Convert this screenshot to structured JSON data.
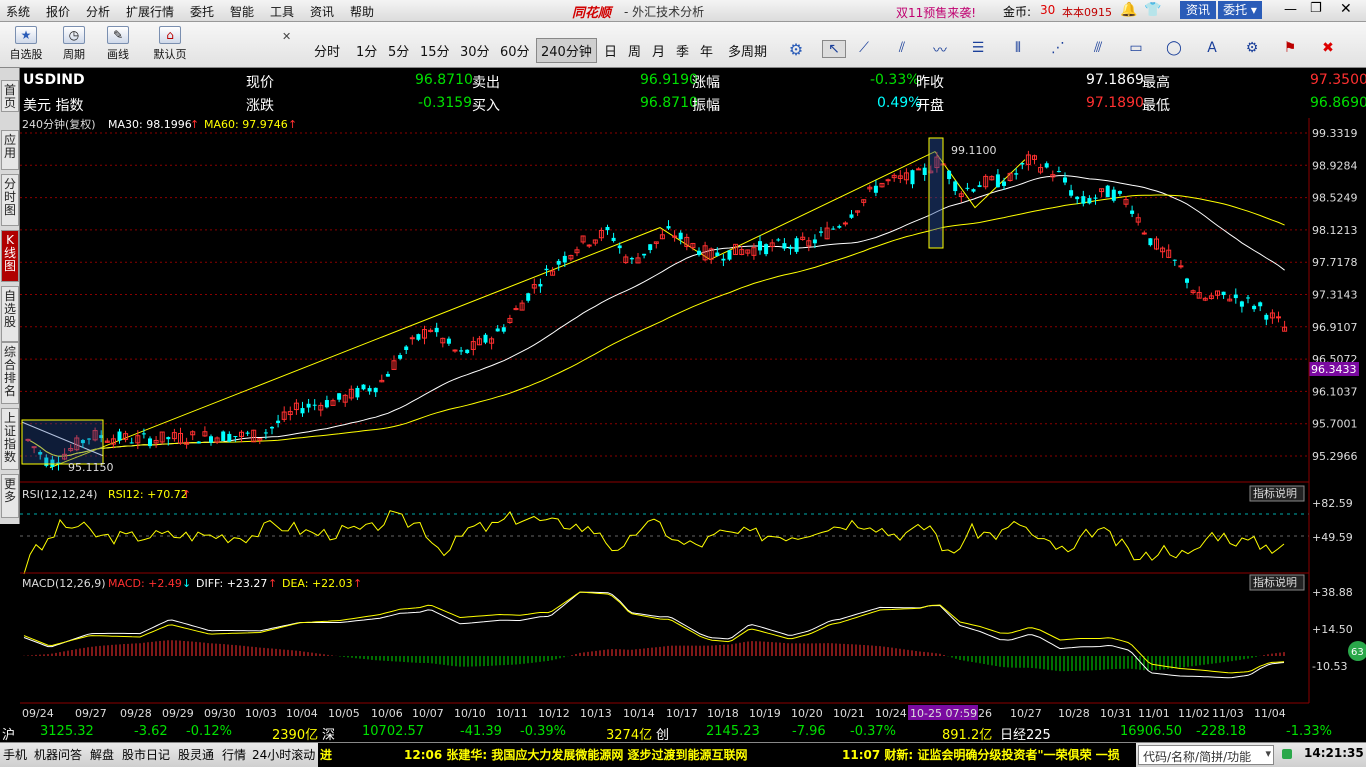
{
  "menu": {
    "items": [
      "系统",
      "报价",
      "分析",
      "扩展行情",
      "委托",
      "智能",
      "工具",
      "资讯",
      "帮助"
    ],
    "brand": "同花顺",
    "app_title": "外汇技术分析",
    "promo": "双11预售来袭!",
    "gold_label": "金币:",
    "gold_value": "30",
    "version": "本本0915",
    "btn_info": "资讯",
    "btn_trade": "委托"
  },
  "toolbar": {
    "left_buttons": [
      "自选股",
      "周期",
      "画线",
      "默认页"
    ],
    "periods": [
      "分时",
      "1分",
      "5分",
      "15分",
      "30分",
      "60分",
      "240分钟",
      "日",
      "周",
      "月",
      "季",
      "年",
      "多周期"
    ],
    "selected_period": "240分钟"
  },
  "sidebar": {
    "tabs": [
      "首页",
      "应用",
      "分时图",
      "K线图",
      "自选股",
      "综合排名",
      "上证指数",
      "更多"
    ],
    "active": "K线图"
  },
  "quote": {
    "symbol": "USDIND",
    "name": "美元 指数",
    "label_now": "现价",
    "now": "96.8710",
    "label_sell": "卖出",
    "sell": "96.9190",
    "label_chg_pct": "涨幅",
    "chg_pct": "-0.33%",
    "label_prev": "昨收",
    "prev": "97.1869",
    "label_high": "最高",
    "high": "97.3500",
    "label_chg": "涨跌",
    "chg": "-0.3159",
    "label_buy": "买入",
    "buy": "96.8710",
    "label_amp": "振幅",
    "amp": "0.49%",
    "label_open": "开盘",
    "open": "97.1890",
    "label_low": "最低",
    "low": "96.8690"
  },
  "main_chart": {
    "header": "240分钟(复权)",
    "ma30_label": "MA30: 98.1996",
    "ma60_label": "MA60: 97.9746",
    "price_ticks": [
      "99.3319",
      "98.9284",
      "98.5249",
      "98.1213",
      "97.7178",
      "97.3143",
      "96.9107",
      "96.5072",
      "96.1037",
      "95.7001",
      "95.2966"
    ],
    "current_tag": "96.3433",
    "annot_high": "99.1100",
    "annot_low": "95.1150"
  },
  "rsi": {
    "header": "RSI(12,12,24)",
    "value": "RSI12: +70.72",
    "btn": "指标说明",
    "ticks": [
      "+82.59",
      "+49.59"
    ]
  },
  "macd": {
    "header": "MACD(12,26,9)",
    "macd": "MACD: +2.49",
    "diff": "DIFF: +23.27",
    "dea": "DEA: +22.03",
    "btn": "指标说明",
    "ticks": [
      "+38.88",
      "+14.50",
      "-10.53"
    ],
    "badge": "63"
  },
  "dates": [
    "09/24",
    "09/27",
    "09/28",
    "09/29",
    "09/30",
    "10/03",
    "10/04",
    "10/05",
    "10/06",
    "10/07",
    "10/10",
    "10/11",
    "10/12",
    "10/13",
    "10/14",
    "10/17",
    "10/18",
    "10/19",
    "10/20",
    "10/21",
    "10/24",
    "10-25 07:59",
    "26",
    "10/27",
    "10/28",
    "10/31",
    "11/01",
    "11/02",
    "11/03",
    "11/04"
  ],
  "status": {
    "sh_label": "沪",
    "sh": "3125.32",
    "sh_chg": "-3.62",
    "sh_pct": "-0.12%",
    "sh_vol": "2390亿",
    "sz_label": "深",
    "sz": "10702.57",
    "sz_chg": "-41.39",
    "sz_pct": "-0.39%",
    "sz_vol": "3274亿",
    "cy_label": "创",
    "cy": "2145.23",
    "cy_chg": "-7.96",
    "cy_pct": "-0.37%",
    "cy_vol": "891.2亿",
    "rj_label": "日经225",
    "rj": "16906.50",
    "rj_chg": "-228.18",
    "rj_pct": "-1.33%"
  },
  "taskbar": {
    "tabs": [
      "手机",
      "机器问答",
      "解盘",
      "股市日记",
      "股灵通",
      "行情",
      "24小时滚动"
    ],
    "news1": "进",
    "news2": "12:06 张建华: 我国应大力发展微能源网 逐步过渡到能源互联网",
    "news3": "11:07 财新: 证监会明确分级投资者\"一荣俱荣 一损",
    "search": "代码/名称/简拼/功能",
    "time": "14:21:35"
  },
  "colors": {
    "up": "#ff3030",
    "down": "#00ffff",
    "ma30": "#ffffff",
    "ma60": "#ffff00",
    "grid": "#8b0000",
    "text_green": "#00e000"
  }
}
